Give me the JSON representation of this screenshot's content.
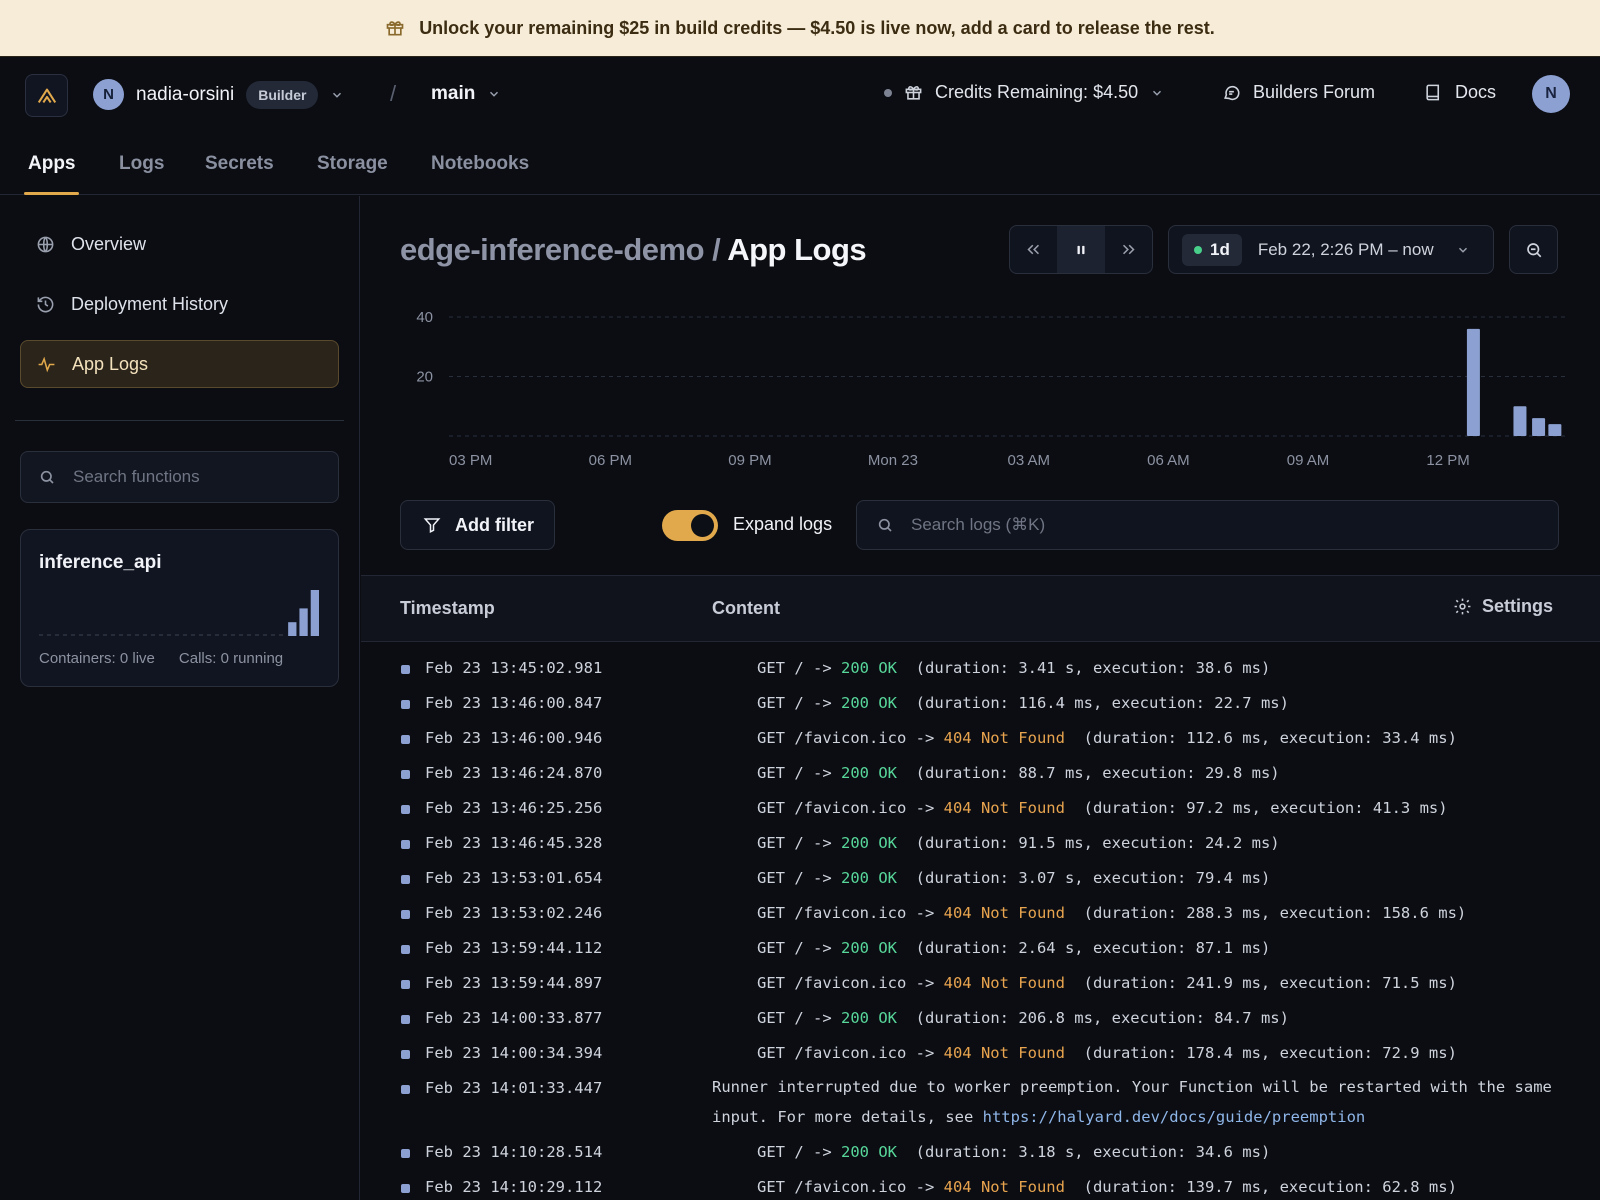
{
  "banner": {
    "text": "Unlock your remaining $25 in build credits — $4.50 is live now, add a card to release the rest.",
    "icon": "gift-icon"
  },
  "topbar": {
    "org_initial": "N",
    "org_name": "nadia-orsini",
    "plan_badge": "Builder",
    "separator": "/",
    "environment": "main",
    "credits_label": "Credits Remaining: $4.50",
    "forum_label": "Builders Forum",
    "docs_label": "Docs",
    "user_initial": "N"
  },
  "tabs": [
    {
      "label": "Apps",
      "active": true
    },
    {
      "label": "Logs"
    },
    {
      "label": "Secrets"
    },
    {
      "label": "Storage"
    },
    {
      "label": "Notebooks"
    }
  ],
  "sidebar": {
    "items": [
      {
        "label": "Overview",
        "icon": "globe-icon"
      },
      {
        "label": "Deployment History",
        "icon": "history-icon"
      },
      {
        "label": "App Logs",
        "icon": "activity-icon",
        "active": true
      }
    ],
    "search_placeholder": "Search functions",
    "function_card": {
      "name": "inference_api",
      "containers": "Containers: 0 live",
      "calls": "Calls: 0 running",
      "spark_values": [
        0,
        0,
        0,
        0,
        0,
        0,
        0,
        0,
        0,
        0,
        0,
        0,
        0,
        0,
        0,
        0,
        0,
        0,
        0,
        0,
        0,
        0,
        0.3,
        0.6,
        1.0
      ]
    }
  },
  "header": {
    "app_name": "edge-inference-demo",
    "separator": "/",
    "page_title": "App Logs",
    "range_pill": "1d",
    "range_text": "Feb 22, 2:26 PM – now"
  },
  "chart_data": {
    "type": "bar",
    "x_tick_labels": [
      "03 PM",
      "06 PM",
      "09 PM",
      "Mon 23",
      "03 AM",
      "06 AM",
      "09 AM",
      "12 PM"
    ],
    "y_ticks": [
      20,
      40
    ],
    "ylim": [
      0,
      42
    ],
    "grid": true,
    "bar_color": "#8ca0d2",
    "bars": [
      {
        "x_hours": 22.0,
        "value": 36
      },
      {
        "x_hours": 23.0,
        "value": 10
      },
      {
        "x_hours": 23.4,
        "value": 6
      },
      {
        "x_hours": 23.75,
        "value": 4
      }
    ]
  },
  "controls": {
    "add_filter": "Add filter",
    "expand_logs": "Expand logs",
    "expand_on": true,
    "search_placeholder": "Search logs (⌘K)"
  },
  "table": {
    "col_timestamp": "Timestamp",
    "col_content": "Content",
    "settings": "Settings"
  },
  "logs": [
    {
      "ts": "Feb 23 13:45:02.981",
      "method": "GET / -> ",
      "status": "200 OK",
      "kind": "ok",
      "detail": "  (duration: 3.41 s, execution: 38.6 ms)"
    },
    {
      "ts": "Feb 23 13:46:00.847",
      "method": "GET / -> ",
      "status": "200 OK",
      "kind": "ok",
      "detail": "  (duration: 116.4 ms, execution: 22.7 ms)"
    },
    {
      "ts": "Feb 23 13:46:00.946",
      "method": "GET /favicon.ico -> ",
      "status": "404 Not Found",
      "kind": "nf",
      "detail": "  (duration: 112.6 ms, execution: 33.4 ms)"
    },
    {
      "ts": "Feb 23 13:46:24.870",
      "method": "GET / -> ",
      "status": "200 OK",
      "kind": "ok",
      "detail": "  (duration: 88.7 ms, execution: 29.8 ms)"
    },
    {
      "ts": "Feb 23 13:46:25.256",
      "method": "GET /favicon.ico -> ",
      "status": "404 Not Found",
      "kind": "nf",
      "detail": "  (duration: 97.2 ms, execution: 41.3 ms)"
    },
    {
      "ts": "Feb 23 13:46:45.328",
      "method": "GET / -> ",
      "status": "200 OK",
      "kind": "ok",
      "detail": "  (duration: 91.5 ms, execution: 24.2 ms)"
    },
    {
      "ts": "Feb 23 13:53:01.654",
      "method": "GET / -> ",
      "status": "200 OK",
      "kind": "ok",
      "detail": "  (duration: 3.07 s, execution: 79.4 ms)"
    },
    {
      "ts": "Feb 23 13:53:02.246",
      "method": "GET /favicon.ico -> ",
      "status": "404 Not Found",
      "kind": "nf",
      "detail": "  (duration: 288.3 ms, execution: 158.6 ms)"
    },
    {
      "ts": "Feb 23 13:59:44.112",
      "method": "GET / -> ",
      "status": "200 OK",
      "kind": "ok",
      "detail": "  (duration: 2.64 s, execution: 87.1 ms)"
    },
    {
      "ts": "Feb 23 13:59:44.897",
      "method": "GET /favicon.ico -> ",
      "status": "404 Not Found",
      "kind": "nf",
      "detail": "  (duration: 241.9 ms, execution: 71.5 ms)"
    },
    {
      "ts": "Feb 23 14:00:33.877",
      "method": "GET / -> ",
      "status": "200 OK",
      "kind": "ok",
      "detail": "  (duration: 206.8 ms, execution: 84.7 ms)"
    },
    {
      "ts": "Feb 23 14:00:34.394",
      "method": "GET /favicon.ico -> ",
      "status": "404 Not Found",
      "kind": "nf",
      "detail": "  (duration: 178.4 ms, execution: 72.9 ms)"
    },
    {
      "ts": "Feb 23 14:01:33.447",
      "kind": "text",
      "text": "Runner interrupted due to worker preemption. Your Function will be restarted with the same input. For more details, see ",
      "link": "https://halyard.dev/docs/guide/preemption"
    },
    {
      "ts": "Feb 23 14:10:28.514",
      "method": "GET / -> ",
      "status": "200 OK",
      "kind": "ok",
      "detail": "  (duration: 3.18 s, execution: 34.6 ms)"
    },
    {
      "ts": "Feb 23 14:10:29.112",
      "method": "GET /favicon.ico -> ",
      "status": "404 Not Found",
      "kind": "nf",
      "detail": "  (duration: 139.7 ms, execution: 62.8 ms)"
    }
  ]
}
